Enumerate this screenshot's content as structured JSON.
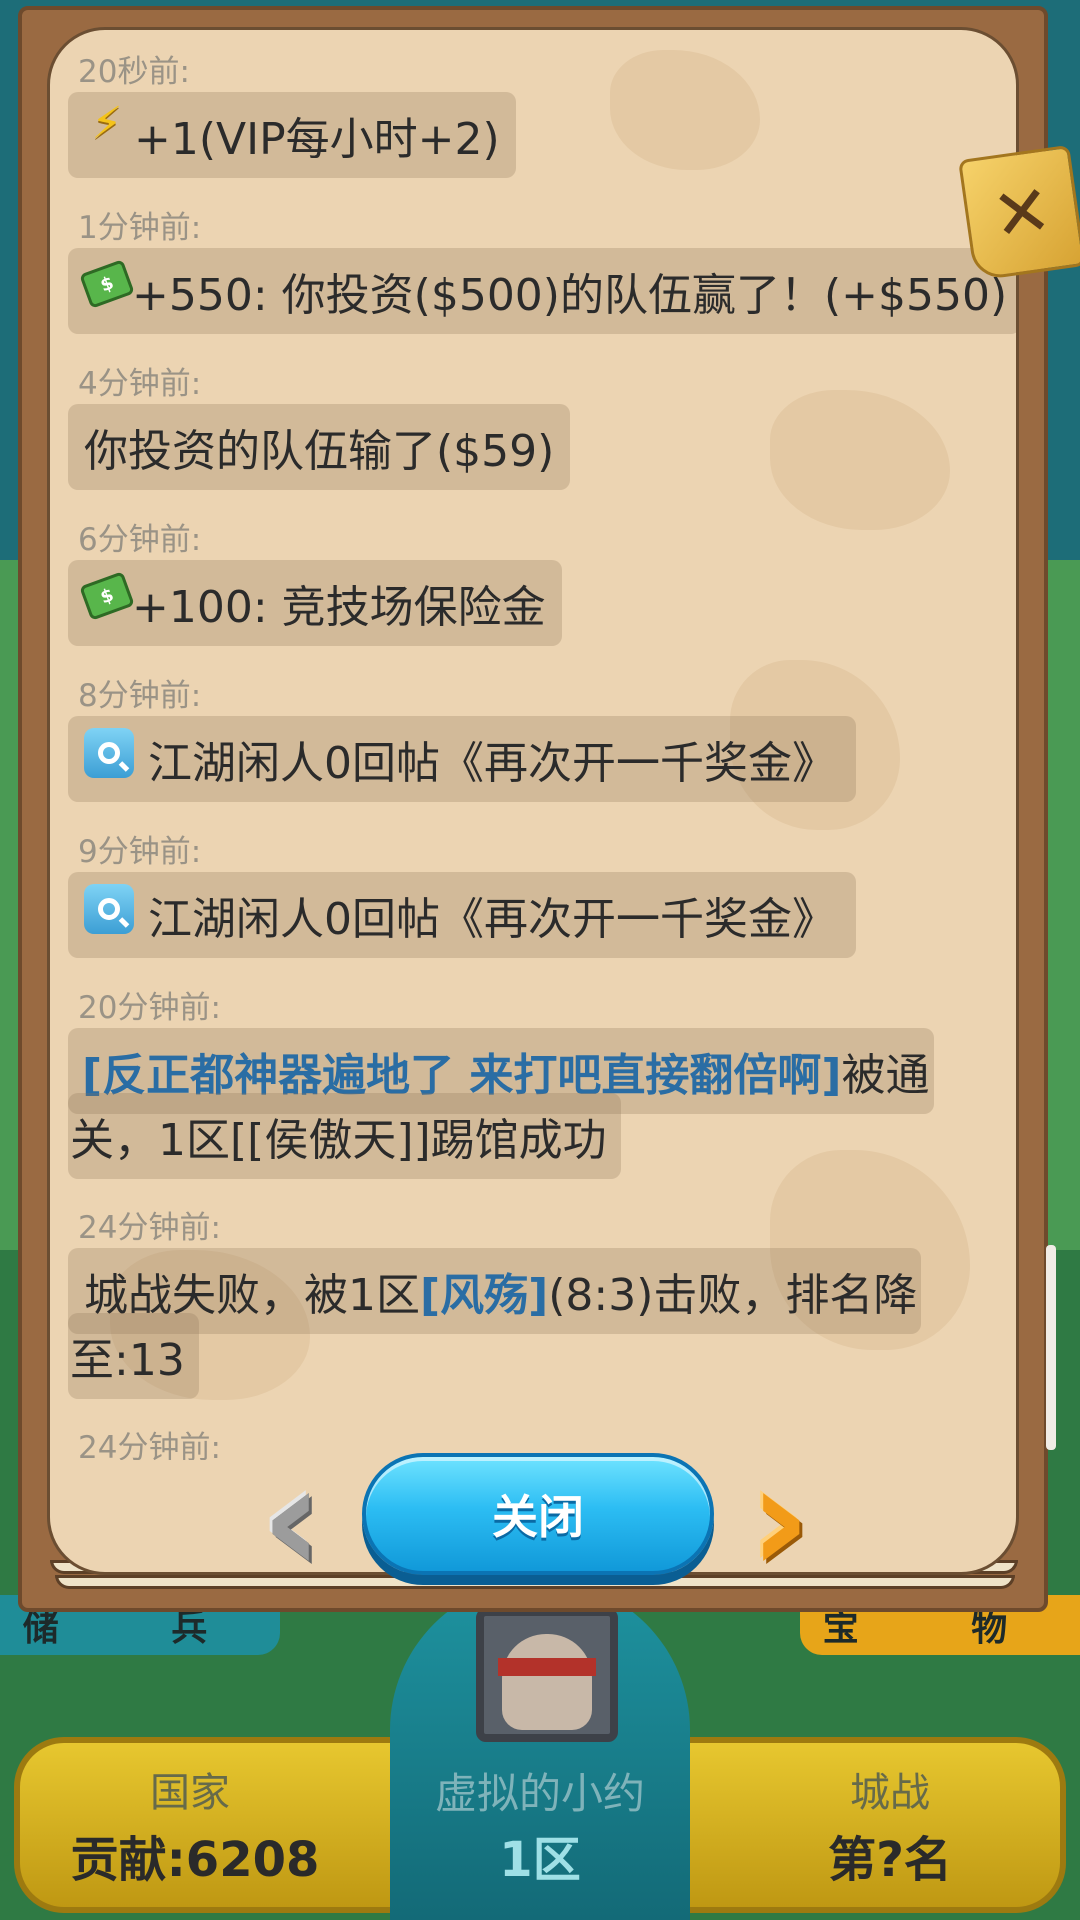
{
  "feed": [
    {
      "time": "20秒前:",
      "icon": "bolt-icon",
      "parts": [
        {
          "text": "+1(VIP每小时+2)"
        }
      ]
    },
    {
      "time": "1分钟前:",
      "icon": "money-icon",
      "parts": [
        {
          "text": "+550: 你投资($500)的队伍赢了！(+$550)"
        }
      ]
    },
    {
      "time": "4分钟前:",
      "icon": "",
      "parts": [
        {
          "text": "你投资的队伍输了($59)"
        }
      ]
    },
    {
      "time": "6分钟前:",
      "icon": "money-icon",
      "parts": [
        {
          "text": "+100: 竞技场保险金"
        }
      ]
    },
    {
      "time": "8分钟前:",
      "icon": "search-icon",
      "parts": [
        {
          "text": "江湖闲人0回帖《再次开一千奖金》"
        }
      ]
    },
    {
      "time": "9分钟前:",
      "icon": "search-icon",
      "parts": [
        {
          "text": "江湖闲人0回帖《再次开一千奖金》"
        }
      ]
    },
    {
      "time": "20分钟前:",
      "icon": "",
      "lines": [
        [
          {
            "text": "[反正都神器遍地了 来打吧直接翻倍啊]",
            "highlight": true
          },
          {
            "text": "被通"
          }
        ],
        [
          {
            "text": "关，1区[[侯傲天]]踢馆成功"
          }
        ]
      ]
    },
    {
      "time": "24分钟前:",
      "icon": "",
      "lines": [
        [
          {
            "text": "城战失败，被1区"
          },
          {
            "text": "[风殇]",
            "highlight": true
          },
          {
            "text": "(8:3)击败，排名降"
          }
        ],
        [
          {
            "text": "至:13"
          }
        ]
      ]
    },
    {
      "time": "24分钟前:",
      "icon": "",
      "parts": []
    }
  ],
  "buttons": {
    "close": "关闭",
    "prev": "‹",
    "next": "›",
    "dismiss": "✕"
  },
  "background": {
    "tab_left": "储 兵",
    "tab_right": "宝 物",
    "stat_left_label": "国家",
    "stat_left_value": "贡献:6208",
    "stat_center_label": "虚拟的小约",
    "stat_center_value": "1区",
    "stat_right_label": "城战",
    "stat_right_value": "第?名"
  },
  "colors": {
    "highlight": "#2a6da4",
    "timestamp": "#9a9386",
    "close_button": "#2cbdf3"
  }
}
